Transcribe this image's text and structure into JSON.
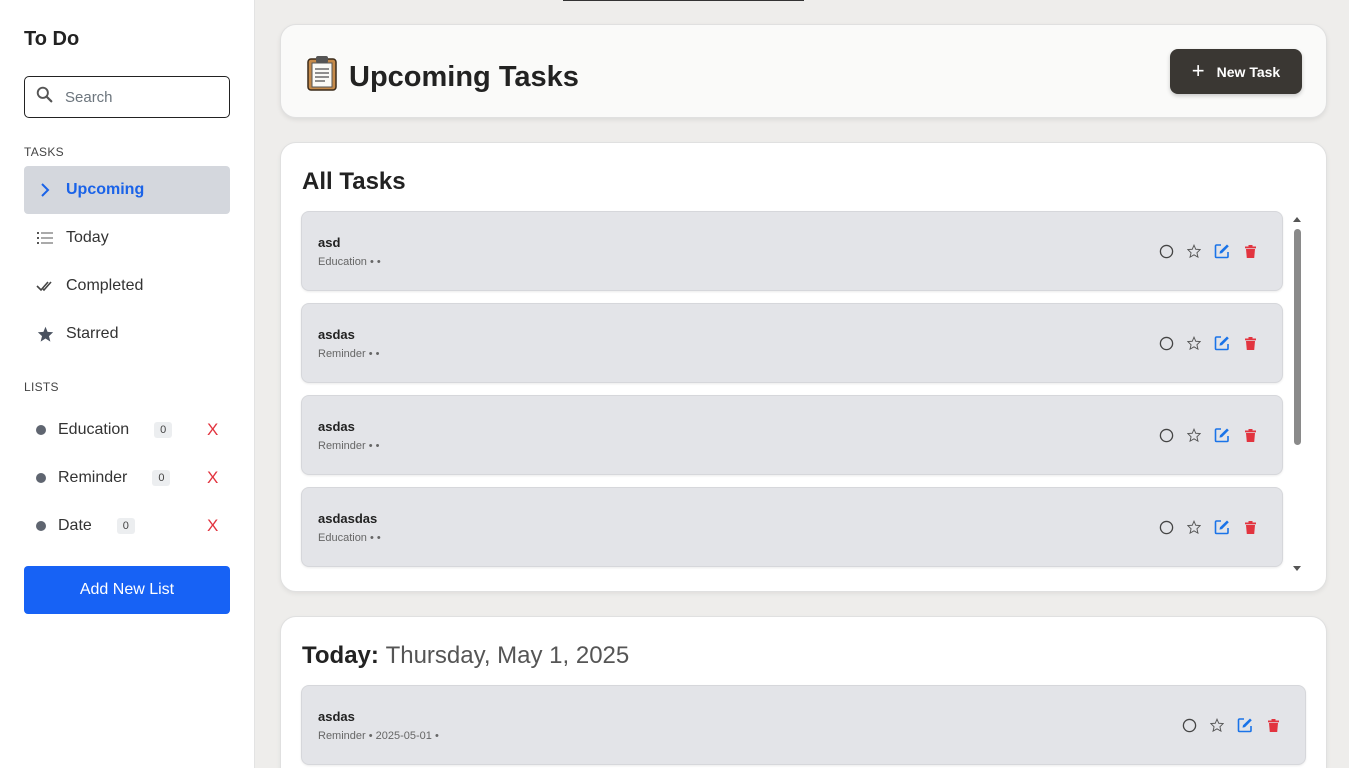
{
  "sidebar": {
    "title": "To Do",
    "search_placeholder": "Search",
    "tasks_label": "TASKS",
    "nav": [
      {
        "label": "Upcoming",
        "icon": "chevron-right-icon",
        "active": true
      },
      {
        "label": "Today",
        "icon": "list-icon",
        "active": false
      },
      {
        "label": "Completed",
        "icon": "double-check-icon",
        "active": false
      },
      {
        "label": "Starred",
        "icon": "star-icon",
        "active": false
      }
    ],
    "lists_label": "LISTS",
    "lists": [
      {
        "name": "Education",
        "count": "0",
        "delete": "X"
      },
      {
        "name": "Reminder",
        "count": "0",
        "delete": "X"
      },
      {
        "name": "Date",
        "count": "0",
        "delete": "X"
      }
    ],
    "add_list_label": "Add New List"
  },
  "header": {
    "icon": "clipboard-icon",
    "title": "Upcoming Tasks",
    "new_task_label": "New Task"
  },
  "all_tasks": {
    "title": "All Tasks",
    "items": [
      {
        "title": "asd",
        "meta": "Education • •"
      },
      {
        "title": "asdas",
        "meta": "Reminder • •"
      },
      {
        "title": "asdas",
        "meta": "Reminder • •"
      },
      {
        "title": "asdasdas",
        "meta": "Education • •"
      }
    ]
  },
  "today": {
    "label": "Today:",
    "date": "Thursday, May 1, 2025",
    "items": [
      {
        "title": "asdas",
        "meta": "Reminder • 2025-05-01 •"
      }
    ]
  },
  "colors": {
    "accent": "#1762f5",
    "active_nav_bg": "#d4d7dd",
    "delete": "#e2343f",
    "edit": "#1a73e8",
    "new_task_btn": "#3a3733"
  }
}
